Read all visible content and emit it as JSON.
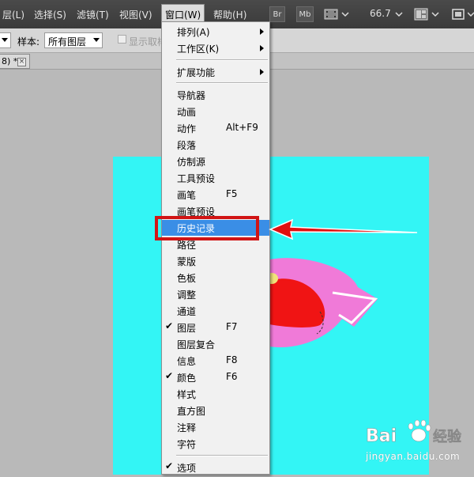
{
  "menubar": {
    "items": [
      "层(L)",
      "选择(S)",
      "滤镜(T)",
      "视图(V)",
      "窗口(W)",
      "帮助(H)"
    ],
    "br_label": "Br",
    "mb_label": "Mb",
    "zoom": "66.7"
  },
  "options": {
    "sample_label": "样本:",
    "sample_value": "所有图层",
    "show_ring_label": "显示取样"
  },
  "doc_tab": {
    "title": "8) *",
    "close": "×"
  },
  "menu": {
    "items": [
      {
        "label": "排列(A)",
        "shortcut": "",
        "submenu": true,
        "checked": false
      },
      {
        "label": "工作区(K)",
        "shortcut": "",
        "submenu": true,
        "checked": false
      },
      {
        "label": "扩展功能",
        "shortcut": "",
        "submenu": true,
        "checked": false
      },
      {
        "label": "导航器",
        "shortcut": "",
        "submenu": false,
        "checked": false
      },
      {
        "label": "动画",
        "shortcut": "",
        "submenu": false,
        "checked": false
      },
      {
        "label": "动作",
        "shortcut": "Alt+F9",
        "submenu": false,
        "checked": false
      },
      {
        "label": "段落",
        "shortcut": "",
        "submenu": false,
        "checked": false
      },
      {
        "label": "仿制源",
        "shortcut": "",
        "submenu": false,
        "checked": false
      },
      {
        "label": "工具预设",
        "shortcut": "",
        "submenu": false,
        "checked": false
      },
      {
        "label": "画笔",
        "shortcut": "F5",
        "submenu": false,
        "checked": false
      },
      {
        "label": "画笔预设",
        "shortcut": "",
        "submenu": false,
        "checked": false
      },
      {
        "label": "历史记录",
        "shortcut": "",
        "submenu": false,
        "checked": false,
        "highlighted": true
      },
      {
        "label": "路径",
        "shortcut": "",
        "submenu": false,
        "checked": false
      },
      {
        "label": "蒙版",
        "shortcut": "",
        "submenu": false,
        "checked": false
      },
      {
        "label": "色板",
        "shortcut": "",
        "submenu": false,
        "checked": false
      },
      {
        "label": "调整",
        "shortcut": "",
        "submenu": false,
        "checked": false
      },
      {
        "label": "通道",
        "shortcut": "",
        "submenu": false,
        "checked": false
      },
      {
        "label": "图层",
        "shortcut": "F7",
        "submenu": false,
        "checked": true
      },
      {
        "label": "图层复合",
        "shortcut": "",
        "submenu": false,
        "checked": false
      },
      {
        "label": "信息",
        "shortcut": "F8",
        "submenu": false,
        "checked": false
      },
      {
        "label": "颜色",
        "shortcut": "F6",
        "submenu": false,
        "checked": true
      },
      {
        "label": "样式",
        "shortcut": "",
        "submenu": false,
        "checked": false
      },
      {
        "label": "直方图",
        "shortcut": "",
        "submenu": false,
        "checked": false
      },
      {
        "label": "注释",
        "shortcut": "",
        "submenu": false,
        "checked": false
      },
      {
        "label": "字符",
        "shortcut": "",
        "submenu": false,
        "checked": false
      },
      {
        "label": "选项",
        "shortcut": "",
        "submenu": false,
        "checked": true
      }
    ]
  },
  "colors": {
    "canvas": "#33f5f5",
    "highlight": "#3a8ee6",
    "annotation": "#d11414",
    "shape_pink": "#f07ad8",
    "shape_red": "#f01414",
    "shape_yellow": "#f0e27a"
  },
  "watermark": {
    "brand_left": "Bai",
    "brand_right": "经验",
    "url": "jingyan.baidu.com"
  }
}
